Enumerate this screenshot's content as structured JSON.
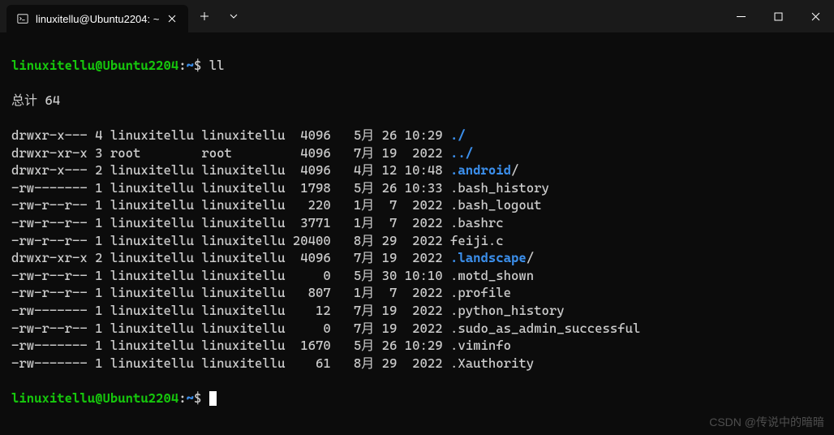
{
  "titlebar": {
    "tab_title": "linuxitellu@Ubuntu2204: ~"
  },
  "prompt": {
    "user_host": "linuxitellu@Ubuntu2204",
    "colon": ":",
    "path": "~",
    "dollar": "$"
  },
  "command": "ll",
  "total_line": "总计 64",
  "listing": [
    {
      "perm": "drwxr-x---",
      "links": "4",
      "owner": "linuxitellu",
      "group": "linuxitellu",
      "size": "4096",
      "month": "5月",
      "day": "26",
      "time": "10:29",
      "name": "./",
      "isdir": true
    },
    {
      "perm": "drwxr-xr-x",
      "links": "3",
      "owner": "root",
      "group": "root",
      "size": "4096",
      "month": "7月",
      "day": "19",
      "time": "2022",
      "name": "../",
      "isdir": true
    },
    {
      "perm": "drwxr-x---",
      "links": "2",
      "owner": "linuxitellu",
      "group": "linuxitellu",
      "size": "4096",
      "month": "4月",
      "day": "12",
      "time": "10:48",
      "name": ".android",
      "suffix": "/",
      "isdir": true
    },
    {
      "perm": "-rw-------",
      "links": "1",
      "owner": "linuxitellu",
      "group": "linuxitellu",
      "size": "1798",
      "month": "5月",
      "day": "26",
      "time": "10:33",
      "name": ".bash_history",
      "isdir": false
    },
    {
      "perm": "-rw-r--r--",
      "links": "1",
      "owner": "linuxitellu",
      "group": "linuxitellu",
      "size": "220",
      "month": "1月",
      "day": "7",
      "time": "2022",
      "name": ".bash_logout",
      "isdir": false
    },
    {
      "perm": "-rw-r--r--",
      "links": "1",
      "owner": "linuxitellu",
      "group": "linuxitellu",
      "size": "3771",
      "month": "1月",
      "day": "7",
      "time": "2022",
      "name": ".bashrc",
      "isdir": false
    },
    {
      "perm": "-rw-r--r--",
      "links": "1",
      "owner": "linuxitellu",
      "group": "linuxitellu",
      "size": "20400",
      "month": "8月",
      "day": "29",
      "time": "2022",
      "name": "feiji.c",
      "isdir": false
    },
    {
      "perm": "drwxr-xr-x",
      "links": "2",
      "owner": "linuxitellu",
      "group": "linuxitellu",
      "size": "4096",
      "month": "7月",
      "day": "19",
      "time": "2022",
      "name": ".landscape",
      "suffix": "/",
      "isdir": true
    },
    {
      "perm": "-rw-r--r--",
      "links": "1",
      "owner": "linuxitellu",
      "group": "linuxitellu",
      "size": "0",
      "month": "5月",
      "day": "30",
      "time": "10:10",
      "name": ".motd_shown",
      "isdir": false
    },
    {
      "perm": "-rw-r--r--",
      "links": "1",
      "owner": "linuxitellu",
      "group": "linuxitellu",
      "size": "807",
      "month": "1月",
      "day": "7",
      "time": "2022",
      "name": ".profile",
      "isdir": false
    },
    {
      "perm": "-rw-------",
      "links": "1",
      "owner": "linuxitellu",
      "group": "linuxitellu",
      "size": "12",
      "month": "7月",
      "day": "19",
      "time": "2022",
      "name": ".python_history",
      "isdir": false
    },
    {
      "perm": "-rw-r--r--",
      "links": "1",
      "owner": "linuxitellu",
      "group": "linuxitellu",
      "size": "0",
      "month": "7月",
      "day": "19",
      "time": "2022",
      "name": ".sudo_as_admin_successful",
      "isdir": false
    },
    {
      "perm": "-rw-------",
      "links": "1",
      "owner": "linuxitellu",
      "group": "linuxitellu",
      "size": "1670",
      "month": "5月",
      "day": "26",
      "time": "10:29",
      "name": ".viminfo",
      "isdir": false
    },
    {
      "perm": "-rw-------",
      "links": "1",
      "owner": "linuxitellu",
      "group": "linuxitellu",
      "size": "61",
      "month": "8月",
      "day": "29",
      "time": "2022",
      "name": ".Xauthority",
      "isdir": false
    }
  ],
  "watermark": "CSDN @传说中的暗暗"
}
